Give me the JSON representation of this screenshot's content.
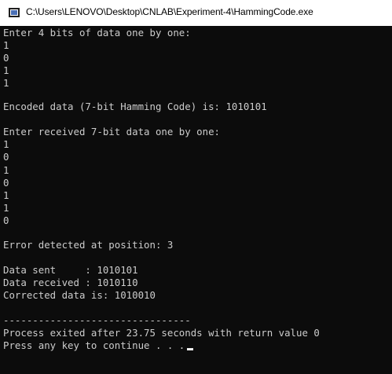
{
  "window": {
    "title": "C:\\Users\\LENOVO\\Desktop\\CNLAB\\Experiment-4\\HammingCode.exe",
    "icon": "console-app-icon"
  },
  "console": {
    "prompt_data": "Enter 4 bits of data one by one:",
    "data_bits": [
      "1",
      "0",
      "1",
      "1"
    ],
    "encoded_line": "Encoded data (7-bit Hamming Code) is: 1010101",
    "prompt_received": "Enter received 7-bit data one by one:",
    "received_bits": [
      "1",
      "0",
      "1",
      "0",
      "1",
      "1",
      "0"
    ],
    "error_line": "Error detected at position: 3",
    "sent_line": "Data sent     : 1010101",
    "received_line": "Data received : 1010110",
    "corrected_line": "Corrected data is: 1010010",
    "separator": "--------------------------------",
    "exit_line": "Process exited after 23.75 seconds with return value 0",
    "continue_line": "Press any key to continue . . ."
  }
}
